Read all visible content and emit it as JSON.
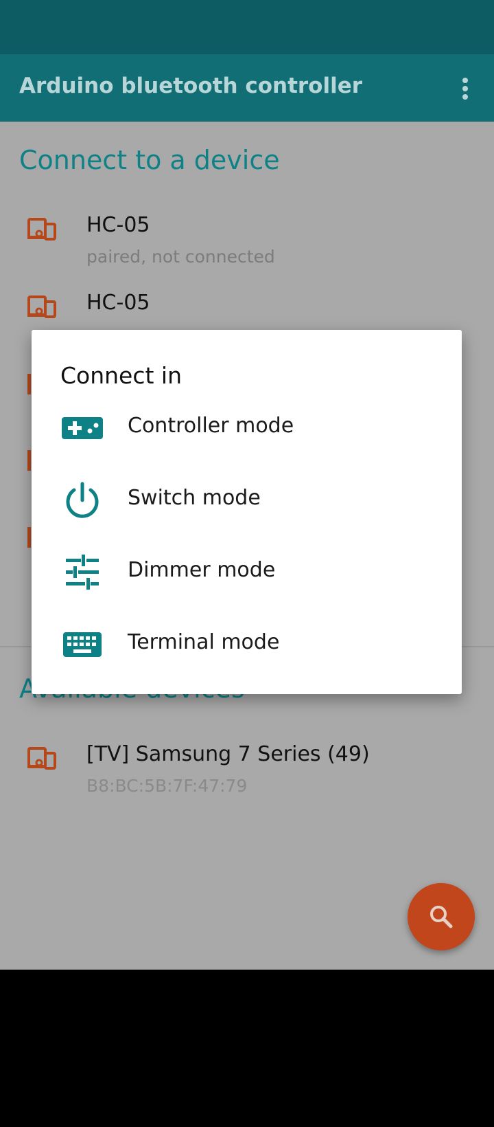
{
  "app_bar": {
    "title": "Arduino bluetooth controller"
  },
  "paired": {
    "title": "Connect to a device",
    "devices": [
      {
        "name": "HC-05",
        "status": "paired, not connected"
      },
      {
        "name": "HC-05",
        "status": ""
      }
    ]
  },
  "available": {
    "title": "Available devices",
    "devices": [
      {
        "name": "[TV] Samsung 7 Series (49)",
        "status": "B8:BC:5B:7F:47:79"
      }
    ]
  },
  "dialog": {
    "title": "Connect in",
    "items": [
      {
        "label": "Controller mode",
        "icon": "gamepad-icon"
      },
      {
        "label": "Switch mode",
        "icon": "power-icon"
      },
      {
        "label": "Dimmer mode",
        "icon": "sliders-icon"
      },
      {
        "label": "Terminal mode",
        "icon": "keyboard-icon"
      }
    ]
  },
  "colors": {
    "status_bar": "#0e5c63",
    "app_bar": "#126e75",
    "accent": "#0e8187",
    "device_icon": "#b5481b",
    "fab": "#c1461b",
    "scrim_bg": "#a9a9a9"
  }
}
